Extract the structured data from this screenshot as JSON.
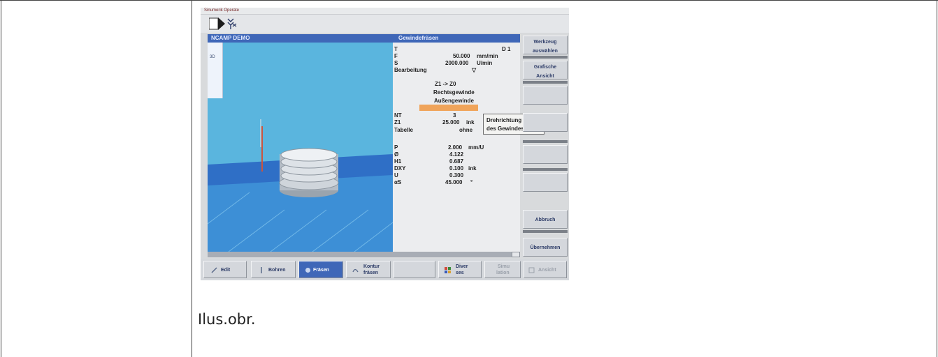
{
  "caption": "Ilus.obr.",
  "screen": {
    "window_title": "Sinumerik Operate",
    "header_left": "NCAMP DEMO",
    "header_right": "Gewindefräsen",
    "viewer_tab": "3D",
    "parameters": [
      {
        "label": "T",
        "value": "",
        "unit": "D 1"
      },
      {
        "label": "F",
        "value": "50.000",
        "unit": "mm/min"
      },
      {
        "label": "S",
        "value": "2000.000",
        "unit": "U/min"
      },
      {
        "label": "Bearbeitung",
        "value": "▽",
        "unit": ""
      },
      {
        "label": "",
        "value": "Z1 -> Z0",
        "unit": ""
      },
      {
        "label": "",
        "value": "Rechtsgewinde",
        "unit": ""
      },
      {
        "label": "",
        "value": "Außengewinde",
        "unit": ""
      },
      {
        "label": "NT",
        "value": "3",
        "unit": ""
      },
      {
        "label": "Z1",
        "value": "25.000",
        "unit": "ink"
      },
      {
        "label": "Tabelle",
        "value": "ohne",
        "unit": ""
      },
      {
        "label": "P",
        "value": "2.000",
        "unit": "mm/U"
      },
      {
        "label": "Ø",
        "value": "4.122",
        "unit": ""
      },
      {
        "label": "H1",
        "value": "0.687",
        "unit": ""
      },
      {
        "label": "DXY",
        "value": "0.100",
        "unit": "ink"
      },
      {
        "label": "U",
        "value": "0.300",
        "unit": ""
      },
      {
        "label": "αS",
        "value": "45.000",
        "unit": "°"
      }
    ],
    "tooltip": {
      "line1": "Drehrichtung",
      "line2": "des Gewindes"
    },
    "vertical_softkeys": [
      {
        "line1": "Werkzeug",
        "line2": "auswählen"
      },
      {
        "line1": "Grafische",
        "line2": "Ansicht"
      },
      {
        "line1": "",
        "line2": ""
      },
      {
        "line1": "",
        "line2": ""
      },
      {
        "line1": "",
        "line2": ""
      },
      {
        "line1": "",
        "line2": ""
      },
      {
        "line1": "Abbruch",
        "line2": ""
      },
      {
        "line1": "Übernehmen",
        "line2": ""
      }
    ],
    "horizontal_softkeys": [
      {
        "line1": "Edit",
        "line2": ""
      },
      {
        "line1": "Bohren",
        "line2": ""
      },
      {
        "line1": "Fräsen",
        "line2": ""
      },
      {
        "line1": "Kontur",
        "line2": "fräsen"
      },
      {
        "line1": "",
        "line2": ""
      },
      {
        "line1": "Diver",
        "line2": "ses"
      },
      {
        "line1": "Simu",
        "line2": "lation"
      },
      {
        "line1": "Ansicht",
        "line2": ""
      }
    ]
  }
}
